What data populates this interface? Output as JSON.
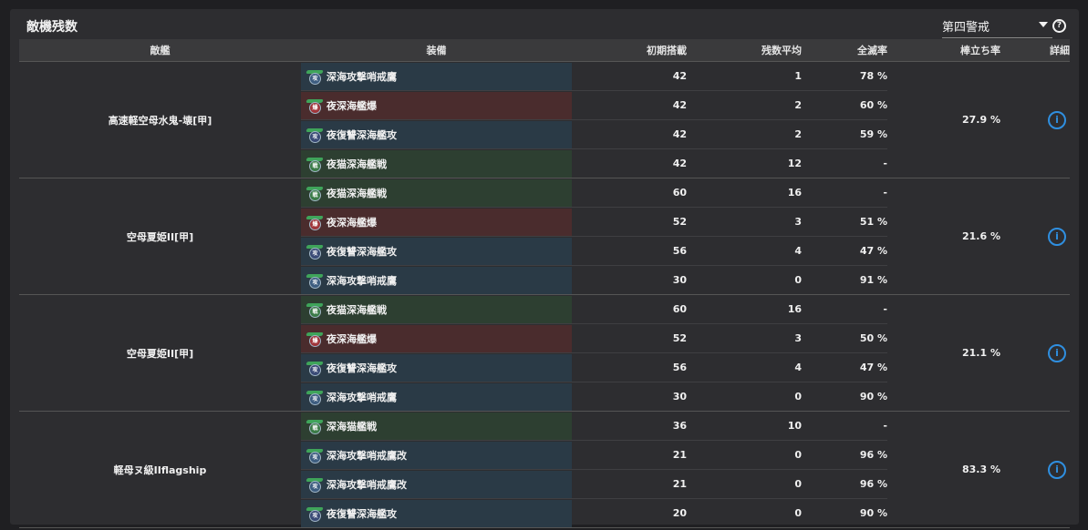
{
  "panel": {
    "title": "敵機残数",
    "selector": {
      "value": "第四警戒"
    },
    "help_icon": "?"
  },
  "table": {
    "headers": {
      "enemy": "敵艦",
      "equip": "装備",
      "initial": "初期搭載",
      "avg": "残数平均",
      "wipe": "全滅率",
      "stand": "棒立ち率",
      "detail": "詳細"
    },
    "groups": [
      {
        "enemy": "高速軽空母水鬼-壊[甲]",
        "stand_rate": "27.9 %",
        "rows": [
          {
            "equip": "深海攻撃哨戒鷹",
            "color": "blue",
            "badge": "攻",
            "badge_color": "blue",
            "initial": "42",
            "avg": "1",
            "wipe": "78 %"
          },
          {
            "equip": "夜深海艦爆",
            "color": "red",
            "badge": "爆",
            "badge_color": "red",
            "initial": "42",
            "avg": "2",
            "wipe": "60 %"
          },
          {
            "equip": "夜復讐深海艦攻",
            "color": "blue",
            "badge": "攻",
            "badge_color": "navy",
            "initial": "42",
            "avg": "2",
            "wipe": "59 %"
          },
          {
            "equip": "夜猫深海艦戦",
            "color": "green",
            "badge": "戦",
            "badge_color": "green",
            "initial": "42",
            "avg": "12",
            "wipe": "-"
          }
        ]
      },
      {
        "enemy": "空母夏姫II[甲]",
        "stand_rate": "21.6 %",
        "rows": [
          {
            "equip": "夜猫深海艦戦",
            "color": "green",
            "badge": "戦",
            "badge_color": "green",
            "initial": "60",
            "avg": "16",
            "wipe": "-"
          },
          {
            "equip": "夜深海艦爆",
            "color": "red",
            "badge": "爆",
            "badge_color": "red",
            "initial": "52",
            "avg": "3",
            "wipe": "51 %"
          },
          {
            "equip": "夜復讐深海艦攻",
            "color": "blue",
            "badge": "攻",
            "badge_color": "navy",
            "initial": "56",
            "avg": "4",
            "wipe": "47 %"
          },
          {
            "equip": "深海攻撃哨戒鷹",
            "color": "blue",
            "badge": "攻",
            "badge_color": "blue",
            "initial": "30",
            "avg": "0",
            "wipe": "91 %"
          }
        ]
      },
      {
        "enemy": "空母夏姫II[甲]",
        "stand_rate": "21.1 %",
        "rows": [
          {
            "equip": "夜猫深海艦戦",
            "color": "green",
            "badge": "戦",
            "badge_color": "green",
            "initial": "60",
            "avg": "16",
            "wipe": "-"
          },
          {
            "equip": "夜深海艦爆",
            "color": "red",
            "badge": "爆",
            "badge_color": "red",
            "initial": "52",
            "avg": "3",
            "wipe": "50 %"
          },
          {
            "equip": "夜復讐深海艦攻",
            "color": "blue",
            "badge": "攻",
            "badge_color": "navy",
            "initial": "56",
            "avg": "4",
            "wipe": "47 %"
          },
          {
            "equip": "深海攻撃哨戒鷹",
            "color": "blue",
            "badge": "攻",
            "badge_color": "blue",
            "initial": "30",
            "avg": "0",
            "wipe": "90 %"
          }
        ]
      },
      {
        "enemy": "軽母ヌ級IIflagship",
        "stand_rate": "83.3 %",
        "rows": [
          {
            "equip": "深海猫艦戦",
            "color": "green",
            "badge": "戦",
            "badge_color": "green",
            "initial": "36",
            "avg": "10",
            "wipe": "-"
          },
          {
            "equip": "深海攻撃哨戒鷹改",
            "color": "blue",
            "badge": "攻",
            "badge_color": "blue",
            "initial": "21",
            "avg": "0",
            "wipe": "96 %"
          },
          {
            "equip": "深海攻撃哨戒鷹改",
            "color": "blue",
            "badge": "攻",
            "badge_color": "blue",
            "initial": "21",
            "avg": "0",
            "wipe": "96 %"
          },
          {
            "equip": "夜復讐深海艦攻",
            "color": "blue",
            "badge": "攻",
            "badge_color": "navy",
            "initial": "20",
            "avg": "0",
            "wipe": "90 %"
          }
        ]
      }
    ]
  }
}
